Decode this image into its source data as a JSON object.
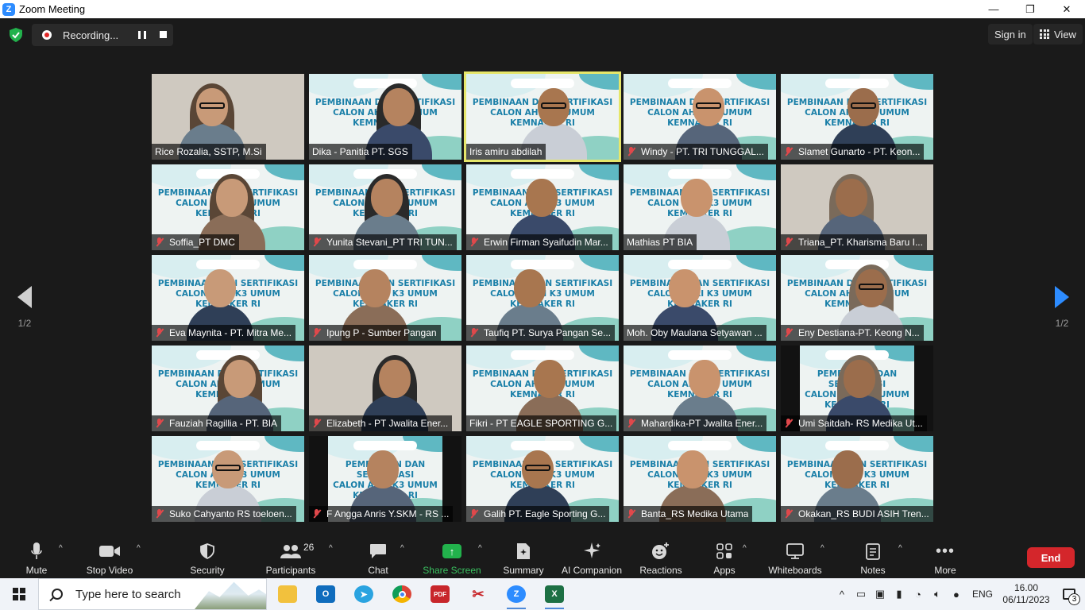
{
  "window": {
    "title": "Zoom Meeting",
    "minimize": "—",
    "maximize": "❐",
    "close": "✕"
  },
  "recording": {
    "label": "Recording..."
  },
  "top": {
    "signin": "Sign in",
    "view": "View"
  },
  "pager": {
    "prev_label": "1/2",
    "next_label": "1/2"
  },
  "banner": {
    "line1": "PEMBINAAN DAN SERTIFIKASI",
    "line2": "CALON AHLI K3 UMUM",
    "line3": "KEMNAKER RI"
  },
  "tiles": [
    {
      "name": "Rice Rozalia, SSTP, M.Si",
      "muted": false,
      "bg": "photo"
    },
    {
      "name": "Dika - Panitia PT. SGS",
      "muted": false,
      "bg": "banner"
    },
    {
      "name": "Iris amiru abdilah",
      "muted": false,
      "bg": "banner",
      "active": true
    },
    {
      "name": "Windy  -  PT. TRI TUNGGAL...",
      "muted": true,
      "bg": "banner"
    },
    {
      "name": "Slamet Gunarto - PT. Keon...",
      "muted": true,
      "bg": "banner"
    },
    {
      "name": "Soffia_PT DMC",
      "muted": true,
      "bg": "banner"
    },
    {
      "name": "Yunita Stevani_PT TRI TUN...",
      "muted": true,
      "bg": "banner"
    },
    {
      "name": "Erwin Firman Syaifudin Mar...",
      "muted": true,
      "bg": "banner"
    },
    {
      "name": "Mathias PT BIA",
      "muted": false,
      "bg": "banner"
    },
    {
      "name": "Triana_PT. Kharisma Baru I...",
      "muted": true,
      "bg": "photo"
    },
    {
      "name": "Eva Maynita - PT. Mitra Me...",
      "muted": true,
      "bg": "banner"
    },
    {
      "name": "Ipung P - Sumber Pangan",
      "muted": true,
      "bg": "banner"
    },
    {
      "name": "Taufiq PT. Surya Pangan Se...",
      "muted": true,
      "bg": "banner"
    },
    {
      "name": "Moh. Oby Maulana Setyawan ...",
      "muted": false,
      "bg": "banner"
    },
    {
      "name": "Eny Destiana-PT. Keong N...",
      "muted": true,
      "bg": "banner"
    },
    {
      "name": "Fauziah Ragillia - PT. BIA",
      "muted": true,
      "bg": "banner"
    },
    {
      "name": "Elizabeth - PT Jwalita Ener...",
      "muted": true,
      "bg": "photo"
    },
    {
      "name": "Fikri - PT EAGLE SPORTING G...",
      "muted": false,
      "bg": "banner"
    },
    {
      "name": "Mahardika-PT Jwalita Ener...",
      "muted": true,
      "bg": "banner"
    },
    {
      "name": "Umi Saitdah- RS Medika Ut...",
      "muted": true,
      "bg": "dark"
    },
    {
      "name": "Suko Cahyanto RS toeloen...",
      "muted": true,
      "bg": "banner"
    },
    {
      "name": "F Angga Anris Y.SKM - RS ...",
      "muted": true,
      "bg": "dark"
    },
    {
      "name": "Galih PT. Eagle Sporting G...",
      "muted": true,
      "bg": "banner"
    },
    {
      "name": "Banta_RS Medika Utama",
      "muted": true,
      "bg": "banner"
    },
    {
      "name": "Okakan_RS BUDI ASIH Tren...",
      "muted": true,
      "bg": "banner"
    }
  ],
  "toolbar": {
    "mute": "Mute",
    "stop_video": "Stop Video",
    "security": "Security",
    "participants": "Participants",
    "participants_count": "26",
    "chat": "Chat",
    "share_screen": "Share Screen",
    "summary": "Summary",
    "ai_companion": "AI Companion",
    "reactions": "Reactions",
    "apps": "Apps",
    "whiteboards": "Whiteboards",
    "notes": "Notes",
    "more": "More",
    "end": "End"
  },
  "taskbar": {
    "search_placeholder": "Type here to search",
    "lang": "ENG",
    "time": "16.00",
    "date": "06/11/2023",
    "notifications": "3"
  },
  "colors": {
    "accent": "#2d8cff",
    "share_green": "#22b24c",
    "end_red": "#d4262b",
    "active_speaker": "#e6e66a"
  }
}
